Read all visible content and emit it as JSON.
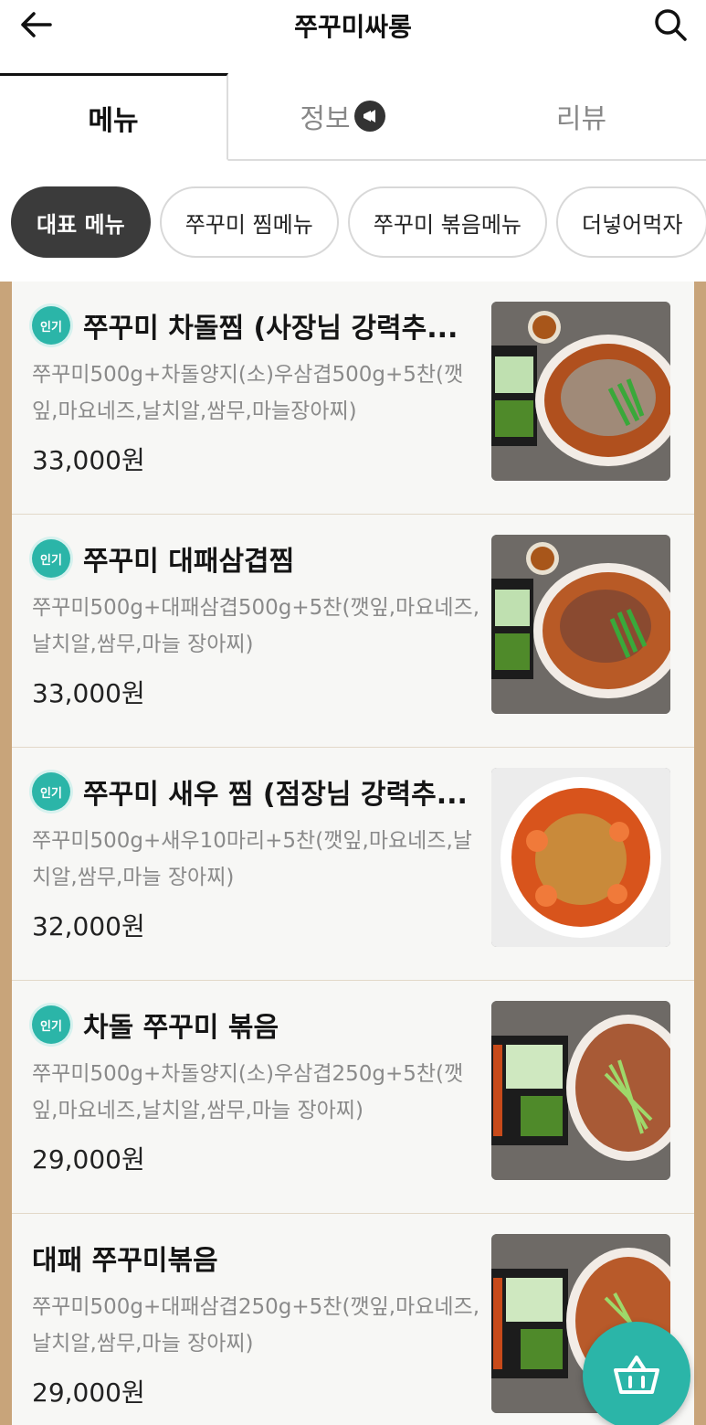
{
  "header": {
    "title": "쭈꾸미싸롱"
  },
  "tabs": [
    {
      "label": "메뉴"
    },
    {
      "label": "정보"
    },
    {
      "label": "리뷰"
    }
  ],
  "chips": [
    {
      "label": "대표 메뉴"
    },
    {
      "label": "쭈꾸미 찜메뉴"
    },
    {
      "label": "쭈꾸미 볶음메뉴"
    },
    {
      "label": "더넣어먹자"
    }
  ],
  "badge_label": "인기",
  "menu": [
    {
      "name": "쭈꾸미 차돌찜 (사장님 강력추...",
      "desc": "쭈꾸미500g+차돌양지(소)우삼겹500g+5찬(깻잎,마요네즈,날치알,쌈무,마늘장아찌)",
      "price": "33,000원",
      "popular": true
    },
    {
      "name": "쭈꾸미 대패삼겹찜",
      "desc": "쭈꾸미500g+대패삼겹500g+5찬(깻잎,마요네즈,날치알,쌈무,마늘 장아찌)",
      "price": "33,000원",
      "popular": true
    },
    {
      "name": "쭈꾸미 새우 찜 (점장님 강력추...",
      "desc": "쭈꾸미500g+새우10마리+5찬(깻잎,마요네즈,날치알,쌈무,마늘 장아찌)",
      "price": "32,000원",
      "popular": true
    },
    {
      "name": "차돌 쭈꾸미 볶음",
      "desc": "쭈꾸미500g+차돌양지(소)우삼겹250g+5찬(깻잎,마요네즈,날치알,쌈무,마늘 장아찌)",
      "price": "29,000원",
      "popular": true
    },
    {
      "name": "대패 쭈꾸미볶음",
      "desc": "쭈꾸미500g+대패삼겹250g+5찬(깻잎,마요네즈,날치알,쌈무,마늘 장아찌)",
      "price": "29,000원",
      "popular": false
    }
  ],
  "colors": {
    "accent": "#2bb5a8",
    "frame": "#c8a47a",
    "chip_active": "#3b3b3b"
  },
  "icons": {
    "back": "arrow-left-icon",
    "search": "search-icon",
    "info_badge": "megaphone-icon",
    "cart": "basket-icon"
  }
}
